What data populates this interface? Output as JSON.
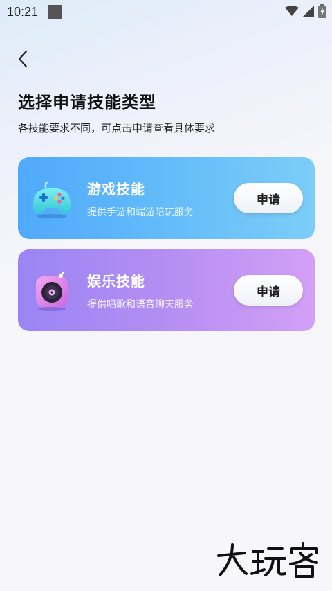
{
  "status_bar": {
    "time": "10:21",
    "icons": [
      "notification-square-icon",
      "wifi-icon",
      "cellular-signal-icon",
      "battery-charging-icon"
    ]
  },
  "header": {
    "back_icon": "chevron-left-icon",
    "title": "选择申请技能类型",
    "subtitle": "各技能要求不同，可点击申请查看具体要求"
  },
  "skills": [
    {
      "title": "游戏技能",
      "description": "提供手游和端游陪玩服务",
      "button_label": "申请",
      "icon": "gamepad-icon",
      "color": "#5aaefb"
    },
    {
      "title": "娱乐技能",
      "description": "提供唱歌和语音聊天服务",
      "button_label": "申请",
      "icon": "music-record-icon",
      "color": "#b48ef2"
    }
  ],
  "watermark": {
    "text": "大玩客"
  }
}
